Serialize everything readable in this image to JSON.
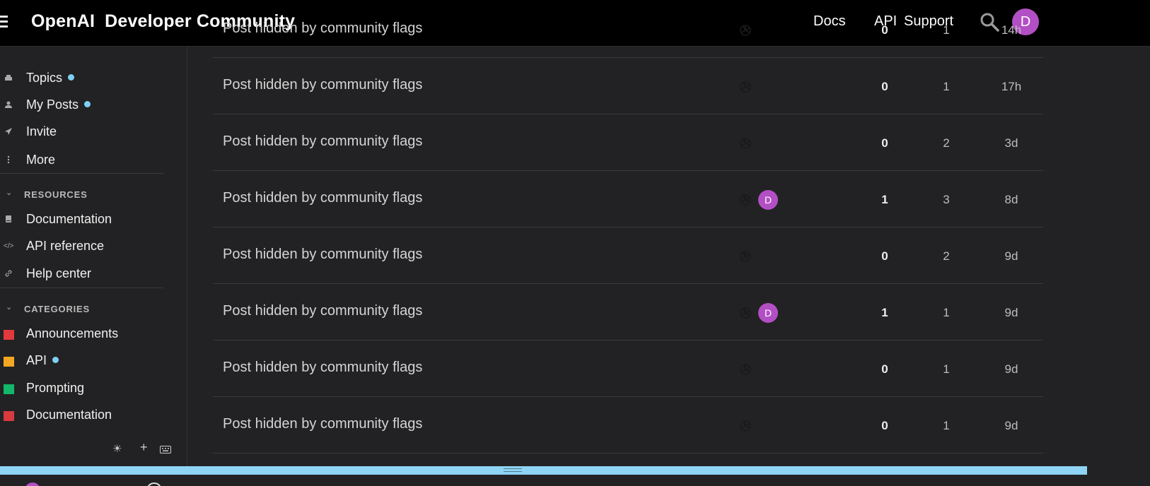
{
  "header": {
    "brand_part1": "OpenAI",
    "brand_part2": "Developer Community",
    "nav": [
      "Docs",
      "API",
      "Support"
    ],
    "user_initial": "D"
  },
  "sidebar": {
    "items": [
      {
        "label": "Topics",
        "icon": "layers-icon"
      },
      {
        "label": "My Posts",
        "icon": "user-icon"
      },
      {
        "label": "Invite",
        "icon": "paper-plane-icon"
      },
      {
        "label": "More",
        "icon": "more-vertical-icon"
      }
    ],
    "resources_heading": "RESOURCES",
    "resources": [
      {
        "label": "Documentation",
        "icon": "book-icon"
      },
      {
        "label": "API reference",
        "icon": "code-icon"
      },
      {
        "label": "Help center",
        "icon": "link-icon"
      }
    ],
    "categories_heading": "CATEGORIES",
    "categories": [
      {
        "label": "Announcements",
        "color": "#e3393d"
      },
      {
        "label": "API",
        "color": "#f5a623"
      },
      {
        "label": "Prompting",
        "color": "#12b76a"
      },
      {
        "label": "Documentation",
        "color": "#d73a3f"
      }
    ],
    "footer_icons": [
      "sun-icon",
      "plus-icon",
      "keyboard-icon"
    ]
  },
  "topics": [
    {
      "title": "Post hidden by community flags",
      "replies": "0",
      "views": "1",
      "activity": "14h",
      "second_poster": ""
    },
    {
      "title": "Post hidden by community flags",
      "replies": "0",
      "views": "1",
      "activity": "17h",
      "second_poster": ""
    },
    {
      "title": "Post hidden by community flags",
      "replies": "0",
      "views": "2",
      "activity": "3d",
      "second_poster": ""
    },
    {
      "title": "Post hidden by community flags",
      "replies": "1",
      "views": "3",
      "activity": "8d",
      "second_poster": "D"
    },
    {
      "title": "Post hidden by community flags",
      "replies": "0",
      "views": "2",
      "activity": "9d",
      "second_poster": ""
    },
    {
      "title": "Post hidden by community flags",
      "replies": "1",
      "views": "1",
      "activity": "9d",
      "second_poster": "D"
    },
    {
      "title": "Post hidden by community flags",
      "replies": "0",
      "views": "1",
      "activity": "9d",
      "second_poster": ""
    },
    {
      "title": "Post hidden by community flags",
      "replies": "0",
      "views": "1",
      "activity": "9d",
      "second_poster": ""
    }
  ],
  "colors": {
    "accent_dot": "#7fd0f5",
    "avatar": "#b34fc4",
    "bottom_bar": "#8fd4f4"
  }
}
